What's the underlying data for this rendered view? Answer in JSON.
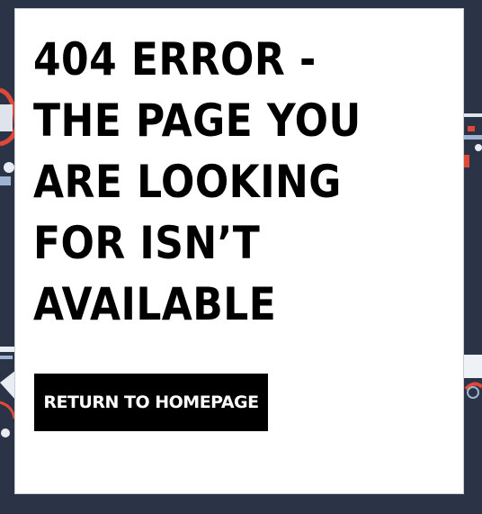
{
  "error": {
    "message": "404 ERROR - THE PAGE YOU ARE LOOKING FOR ISN’T AVAILABLE"
  },
  "actions": {
    "home_label": "RETURN TO HOMEPAGE"
  },
  "colors": {
    "background": "#2b3446",
    "card": "#ffffff",
    "text": "#000000",
    "button_bg": "#000000",
    "button_text": "#ffffff",
    "accent_red": "#e0483a"
  }
}
